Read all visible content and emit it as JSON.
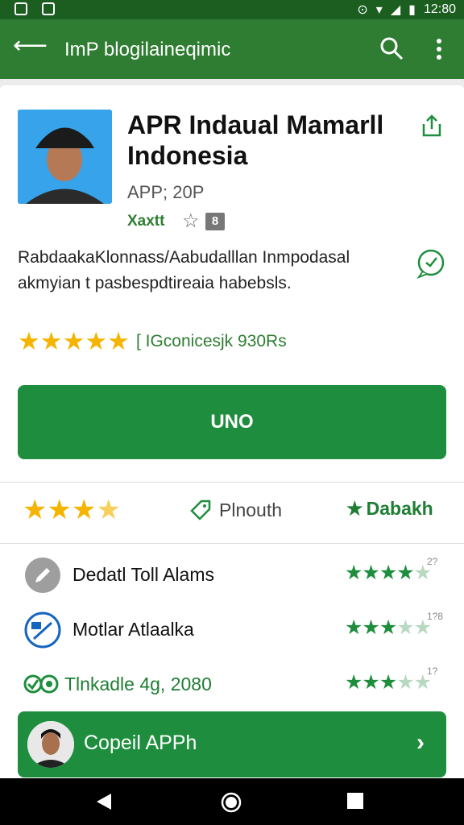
{
  "status": {
    "time": "12:80"
  },
  "appbar": {
    "title": "ImP blogilaineqimic"
  },
  "app": {
    "title": "APR Indaual Mamarll Indonesia",
    "subtitle": "APP; 20P",
    "tag": "Xaxtt",
    "badge": "8",
    "description": "RabdaakaKlonnass/Aabudalllan Inmpodasal akmyian t pasbespdtireaia habebsls.",
    "rating_text": "[ IGconicesjk 930Rs",
    "install_label": "UNO"
  },
  "stats": {
    "middle_label": "Plnouth",
    "right_label": "Dabakh"
  },
  "list": [
    {
      "label": "Dedatl Toll Alams",
      "num": "2?"
    },
    {
      "label": "Motlar Atlaalka",
      "num": "1?8"
    },
    {
      "label": "Tlnkadle 4g, 2080",
      "num": "1?"
    }
  ],
  "cta": {
    "label": "Copeil APPh"
  },
  "colors": {
    "primary": "#2e7d32",
    "accent": "#1e8e3e",
    "star": "#f5b400"
  }
}
